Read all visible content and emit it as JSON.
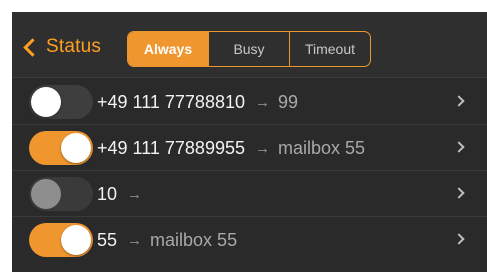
{
  "navbar": {
    "back_label": "Status",
    "segments": [
      {
        "label": "Always",
        "active": true
      },
      {
        "label": "Busy",
        "active": false
      },
      {
        "label": "Timeout",
        "active": false
      }
    ]
  },
  "rows": [
    {
      "number": "+49 111 77788810",
      "arrow": "→",
      "target": "99",
      "toggle": "off"
    },
    {
      "number": "+49 111 77889955",
      "arrow": "→",
      "target": "mailbox 55",
      "toggle": "on"
    },
    {
      "number": "10",
      "arrow": "→",
      "target": "",
      "toggle": "disabled"
    },
    {
      "number": "55",
      "arrow": "→",
      "target": "mailbox 55",
      "toggle": "on"
    }
  ],
  "colors": {
    "accent": "#f0962f",
    "background": "#2a2a2a",
    "text": "#f2f2f2",
    "secondary_text": "#a8a8a8"
  }
}
